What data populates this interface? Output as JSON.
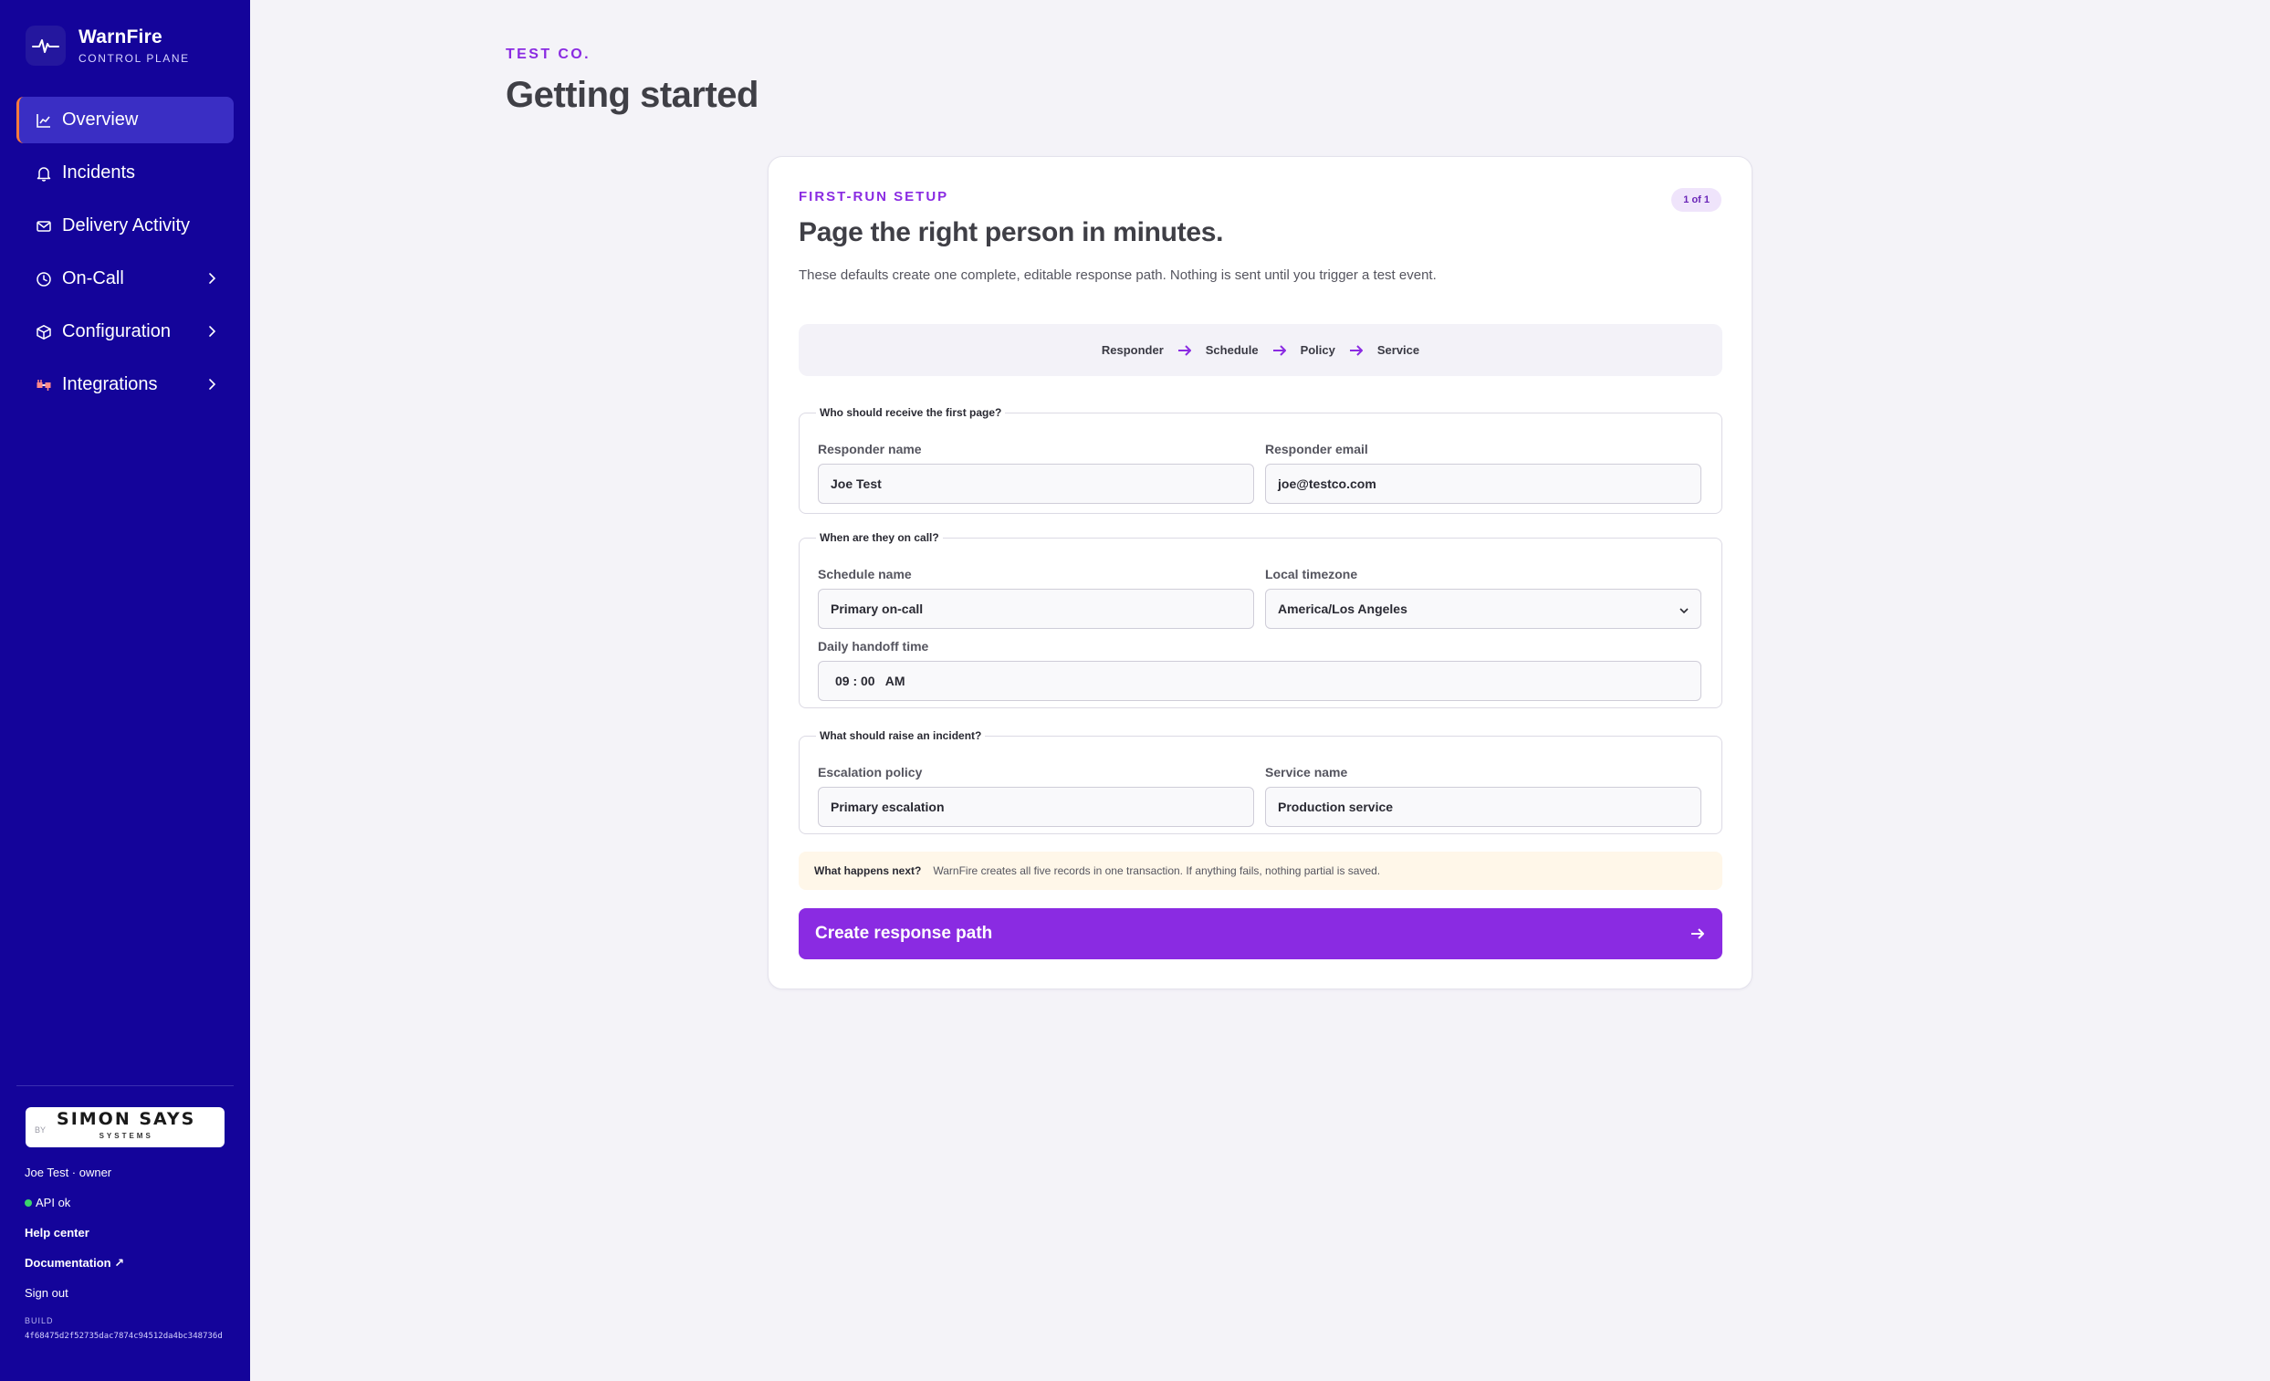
{
  "brand": {
    "name": "WarnFire",
    "subtitle": "CONTROL PLANE"
  },
  "sidebar": {
    "items": [
      {
        "label": "Overview",
        "icon": "chart-line-icon",
        "active": true,
        "has_chevron": false
      },
      {
        "label": "Incidents",
        "icon": "bell-icon",
        "active": false,
        "has_chevron": false
      },
      {
        "label": "Delivery Activity",
        "icon": "mail-icon",
        "active": false,
        "has_chevron": false
      },
      {
        "label": "On-Call",
        "icon": "clock-icon",
        "active": false,
        "has_chevron": true
      },
      {
        "label": "Configuration",
        "icon": "cube-icon",
        "active": false,
        "has_chevron": true
      },
      {
        "label": "Integrations",
        "icon": "plug-icon",
        "active": false,
        "has_chevron": true
      }
    ],
    "partner": {
      "prefix": "BY",
      "name": "SIMON SAYS",
      "sub": "SYSTEMS"
    },
    "user": "Joe Test · owner",
    "api_status": "API ok",
    "help_center": "Help center",
    "documentation": "Documentation ↗",
    "sign_out": "Sign out",
    "build_label": "BUILD",
    "build_hash": "4f68475d2f52735dac7874c94512da4bc348736d"
  },
  "page": {
    "org": "TEST CO.",
    "title": "Getting started"
  },
  "card": {
    "eyebrow": "FIRST-RUN SETUP",
    "badge": "1 of 1",
    "title": "Page the right person in minutes.",
    "description": "These defaults create one complete, editable response path. Nothing is sent until you trigger a test event.",
    "steps": [
      "Responder",
      "Schedule",
      "Policy",
      "Service"
    ],
    "groups": {
      "responder": {
        "legend": "Who should receive the first page?",
        "name_label": "Responder name",
        "name_value": "Joe Test",
        "email_label": "Responder email",
        "email_value": "joe@testco.com"
      },
      "schedule": {
        "legend": "When are they on call?",
        "name_label": "Schedule name",
        "name_value": "Primary on-call",
        "tz_label": "Local timezone",
        "tz_value": "America/Los Angeles",
        "handoff_label": "Daily handoff time",
        "handoff_value": "09 : 00   AM"
      },
      "incident": {
        "legend": "What should raise an incident?",
        "policy_label": "Escalation policy",
        "policy_value": "Primary escalation",
        "service_label": "Service name",
        "service_value": "Production service"
      }
    },
    "note": {
      "title": "What happens next?",
      "text": "WarnFire creates all five records in one transaction. If anything fails, nothing partial is saved."
    },
    "cta_label": "Create response path"
  },
  "colors": {
    "sidebar": "#14049a",
    "accent": "#8a2be2",
    "active_marker": "#ff7a3d",
    "status_ok": "#3bd56b"
  }
}
